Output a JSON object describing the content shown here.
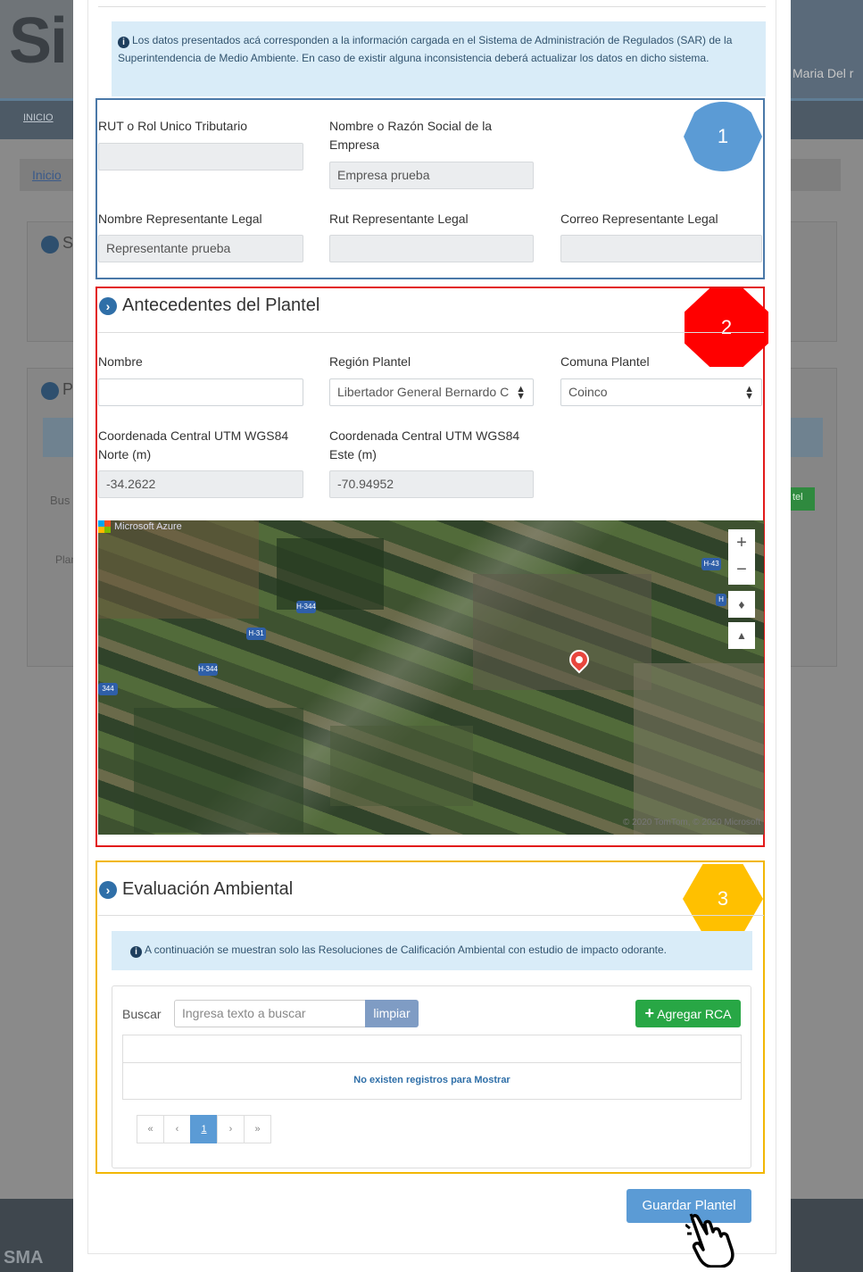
{
  "background": {
    "logo": "Si",
    "user_name": "Maria Del r",
    "nav_link": "INICIO",
    "breadcrumb": "Inicio",
    "footer_brand": "SMA",
    "frag_s": "S",
    "frag_p": "P",
    "frag_bus": "Bus",
    "frag_pla": "Plan",
    "frag_tel": "tel"
  },
  "info_alert": {
    "text": "Los datos presentados acá corresponden a la información cargada en el Sistema de Administración de Regulados (SAR) de la Superintendencia de Medio Ambiente. En caso de existir alguna inconsistencia deberá actualizar los datos en dicho sistema."
  },
  "empresa": {
    "badge": "1",
    "rut_label": "RUT o Rol Unico Tributario",
    "rut_value": "",
    "razon_label": "Nombre o Razón Social de la Empresa",
    "razon_value": "Empresa prueba",
    "rep_nombre_label": "Nombre Representante Legal",
    "rep_nombre_value": "Representante prueba",
    "rep_rut_label": "Rut Representante Legal",
    "rep_rut_value": "",
    "rep_correo_label": "Correo Representante Legal",
    "rep_correo_value": ""
  },
  "plantel": {
    "badge": "2",
    "title": "Antecedentes del Plantel",
    "nombre_label": "Nombre",
    "nombre_value": "",
    "region_label": "Región Plantel",
    "region_value": "Libertador General Bernardo C",
    "comuna_label": "Comuna Plantel",
    "comuna_value": "Coinco",
    "norte_label": "Coordenada Central UTM WGS84 Norte (m)",
    "norte_value": "-34.2622",
    "este_label": "Coordenada Central UTM WGS84 Este (m)",
    "este_value": "-70.94952",
    "map": {
      "brand": "Microsoft Azure",
      "zoom_in": "+",
      "zoom_out": "−",
      "shields": [
        "H-344",
        "H-31",
        "H-344",
        "344",
        "H-43",
        "H"
      ],
      "copyright": "© 2020 TomTom, © 2020 Microsoft"
    }
  },
  "evaluacion": {
    "badge": "3",
    "title": "Evaluación Ambiental",
    "alert": "A continuación se muestran solo las Resoluciones de Calificación Ambiental con estudio de impacto odorante.",
    "search_label": "Buscar",
    "search_placeholder": "Ingresa texto a buscar",
    "clear_label": "limpiar",
    "add_label": "Agregar RCA",
    "empty_text": "No existen registros para Mostrar",
    "pager": [
      "«",
      "‹",
      "1",
      "›",
      "»"
    ]
  },
  "save_label": "Guardar Plantel",
  "colors": {
    "primary": "#5b9bd5",
    "success": "#28a745",
    "box1": "#4a78a8",
    "box2": "#e21a1a",
    "box3": "#f2b705"
  }
}
